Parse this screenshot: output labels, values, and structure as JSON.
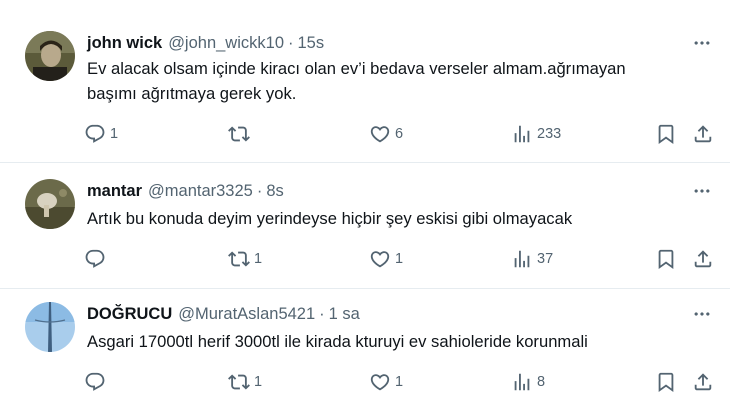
{
  "tweets": [
    {
      "author": {
        "name": "john wick",
        "handle": "@john_wickk10"
      },
      "separator": "·",
      "time": "15s",
      "text": "Ev alacak olsam içinde kiracı olan ev’i bedava verseler almam.ağrımayan\nbaşımı ağrıtmaya gerek yok.",
      "stats": {
        "replies": "1",
        "retweets": "",
        "likes": "6",
        "views": "233"
      }
    },
    {
      "author": {
        "name": "mantar",
        "handle": "@mantar3325"
      },
      "separator": "·",
      "time": "8s",
      "text": "Artık bu konuda deyim yerindeyse hiçbir şey eskisi gibi olmayacak",
      "stats": {
        "replies": "",
        "retweets": "1",
        "likes": "1",
        "views": "37"
      }
    },
    {
      "author": {
        "name": "DOĞRUCU",
        "handle": "@MuratAslan5421"
      },
      "separator": "·",
      "time": "1 sa",
      "text": "Asgari 17000tl herif 3000tl ile kirada kturuyi ev sahioleride korunmali",
      "stats": {
        "replies": "",
        "retweets": "1",
        "likes": "1",
        "views": "8"
      }
    }
  ],
  "icons": {
    "reply": "reply-icon",
    "retweet": "retweet-icon",
    "like": "heart-icon",
    "views": "views-chart-icon",
    "bookmark": "bookmark-icon",
    "share": "share-icon",
    "more": "more-options-icon"
  },
  "colors": {
    "icon_gray": "#536471",
    "text": "#0f1419",
    "divider": "#e6ecf0"
  }
}
